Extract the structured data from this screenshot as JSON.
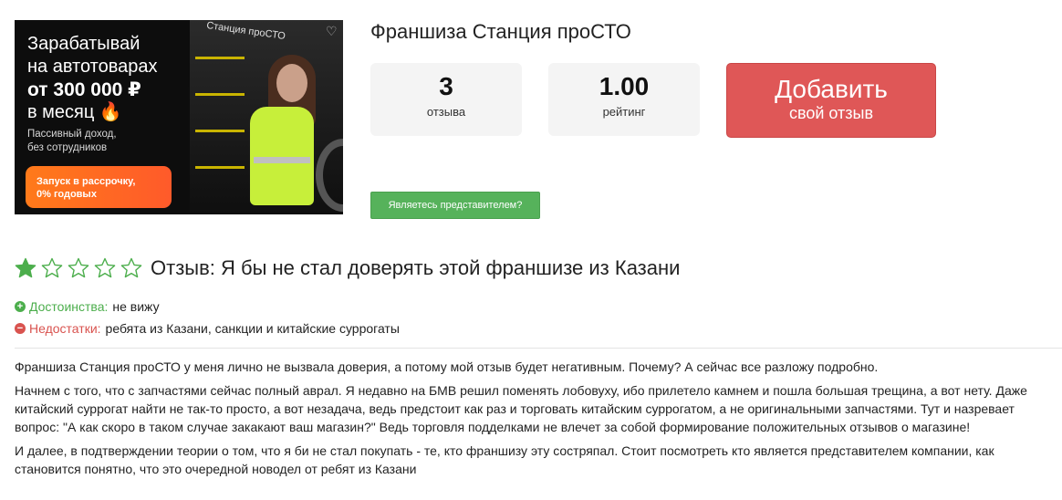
{
  "banner": {
    "line1": "Зарабатывай",
    "line2": "на автотоварах",
    "line3": "от 300 000 ₽",
    "line4": "в месяц 🔥",
    "small1": "Пассивный доход,",
    "small2": "без сотрудников",
    "cta1": "Запуск в рассрочку,",
    "cta2": "0% годовых",
    "sign": "Станция проСТО"
  },
  "header": {
    "title": "Франшиза Станция проСТО"
  },
  "stats": {
    "reviews_count": "3",
    "reviews_label": "отзыва",
    "rating_value": "1.00",
    "rating_label": "рейтинг"
  },
  "actions": {
    "add_line1": "Добавить",
    "add_line2": "свой отзыв",
    "representative": "Являетесь представителем?"
  },
  "review": {
    "rating": 1,
    "max_rating": 5,
    "title": "Отзыв: Я бы не стал доверять этой франшизе из Казани",
    "pros_label": "Достоинства:",
    "pros_value": "не вижу",
    "cons_label": "Недостатки:",
    "cons_value": "ребята из Казани, санкции и китайские суррогаты",
    "p1": "Франшиза Станция проСТО у меня лично не вызвала доверия, а потому мой отзыв будет негативным. Почему? А сейчас все разложу подробно.",
    "p2": "Начнем с того, что с запчастями сейчас полный аврал. Я недавно на БМВ решил поменять лобовуху, ибо прилетело камнем и пошла большая трещина, а вот нету. Даже китайский суррогат найти не так-то просто, а вот незадача, ведь предстоит как раз и торговать китайским суррогатом, а не оригинальными запчастями. Тут и назревает вопрос: \"А как скоро в таком случае закакают ваш магазин?\" Ведь торговля подделками не влечет за собой формирование положительных отзывов о магазине!",
    "p3": "И далее, в подтверждении теории о том, что я би не стал покупать - те, кто франшизу эту состряпал. Стоит посмотреть кто является представителем компании, как становится понятно, что это очередной новодел от ребят из Казани"
  },
  "colors": {
    "add_button": "#df5757",
    "rep_button": "#56b25b",
    "star_filled": "#4cae4c",
    "star_empty_stroke": "#4cae4c",
    "pros": "#4cae4c",
    "cons": "#d9534f"
  },
  "icons": {
    "heart": "heart-icon",
    "star": "star-icon",
    "plus": "plus-circle-icon",
    "minus": "minus-circle-icon"
  }
}
